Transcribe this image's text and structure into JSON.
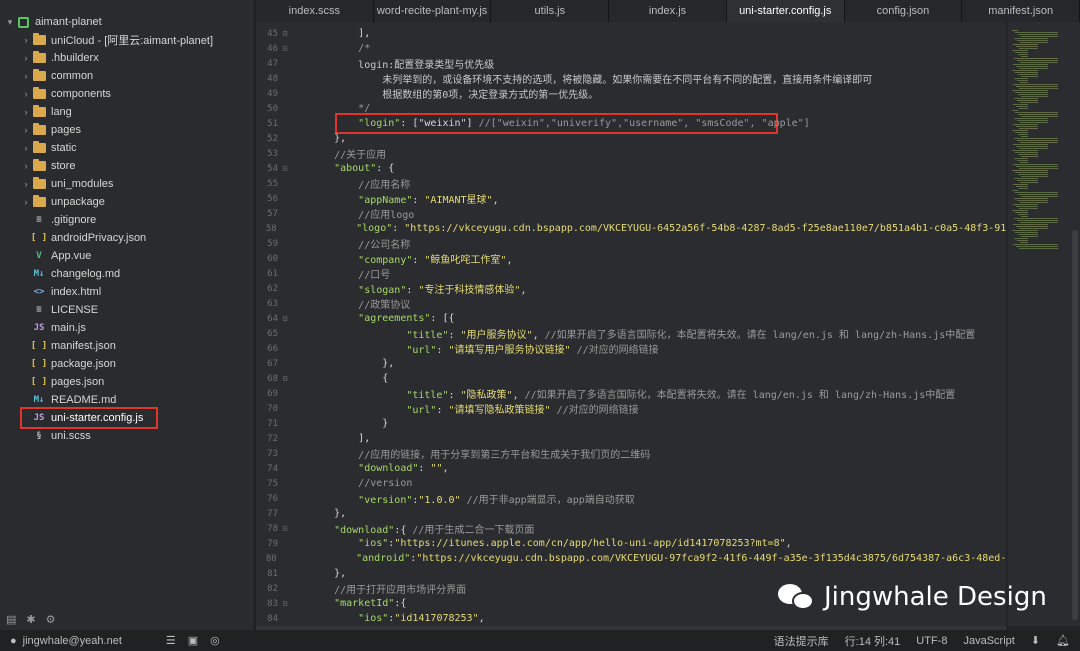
{
  "sidebar": {
    "root": "aimant-planet",
    "items": [
      {
        "type": "folder",
        "label": "uniCloud - [阿里云:aimant-planet]"
      },
      {
        "type": "folder",
        "label": ".hbuilderx"
      },
      {
        "type": "folder",
        "label": "common"
      },
      {
        "type": "folder",
        "label": "components"
      },
      {
        "type": "folder",
        "label": "lang"
      },
      {
        "type": "folder",
        "label": "pages"
      },
      {
        "type": "folder",
        "label": "static"
      },
      {
        "type": "folder",
        "label": "store"
      },
      {
        "type": "folder",
        "label": "uni_modules"
      },
      {
        "type": "folder",
        "label": "unpackage"
      },
      {
        "type": "file",
        "icon": "doc",
        "label": ".gitignore"
      },
      {
        "type": "file",
        "icon": "json",
        "label": "androidPrivacy.json"
      },
      {
        "type": "file",
        "icon": "vue",
        "label": "App.vue"
      },
      {
        "type": "file",
        "icon": "md",
        "label": "changelog.md"
      },
      {
        "type": "file",
        "icon": "html",
        "label": "index.html"
      },
      {
        "type": "file",
        "icon": "doc",
        "label": "LICENSE"
      },
      {
        "type": "file",
        "icon": "js",
        "label": "main.js"
      },
      {
        "type": "file",
        "icon": "json",
        "label": "manifest.json"
      },
      {
        "type": "file",
        "icon": "json",
        "label": "package.json"
      },
      {
        "type": "file",
        "icon": "json",
        "label": "pages.json"
      },
      {
        "type": "file",
        "icon": "md",
        "label": "README.md"
      },
      {
        "type": "file",
        "icon": "js",
        "label": "uni-starter.config.js",
        "selected": true
      },
      {
        "type": "file",
        "icon": "css",
        "label": "uni.scss"
      }
    ]
  },
  "tabs": [
    {
      "label": "index.scss"
    },
    {
      "label": "word-recite-plant-my.js"
    },
    {
      "label": "utils.js"
    },
    {
      "label": "index.js"
    },
    {
      "label": "uni-starter.config.js",
      "active": true
    },
    {
      "label": "config.json"
    },
    {
      "label": "manifest.json"
    }
  ],
  "editor": {
    "lines": [
      {
        "n": "45",
        "fold": "⊟",
        "indent": "        ",
        "tokens": [
          [
            "p",
            "],"
          ]
        ]
      },
      {
        "n": "46",
        "fold": "⊟",
        "indent": "        ",
        "tokens": [
          [
            "c",
            "/*"
          ]
        ]
      },
      {
        "n": "47",
        "fold": "",
        "indent": "        ",
        "tokens": [
          [
            "cn",
            "login:配置登录类型与优先级"
          ]
        ]
      },
      {
        "n": "48",
        "fold": "",
        "indent": "            ",
        "tokens": [
          [
            "cn",
            "未列举到的，或设备环境不支持的选项，将被隐藏。如果你需要在不同平台有不同的配置，直接用条件编译即可"
          ]
        ]
      },
      {
        "n": "49",
        "fold": "",
        "indent": "            ",
        "tokens": [
          [
            "cn",
            "根据数组的第0项，决定登录方式的第一优先级。"
          ]
        ]
      },
      {
        "n": "50",
        "fold": "",
        "indent": "        ",
        "tokens": [
          [
            "c",
            "*/"
          ]
        ]
      },
      {
        "n": "51",
        "fold": "",
        "indent": "        ",
        "tokens": [
          [
            "k",
            "\"login\""
          ],
          [
            "p",
            ": [\"weixin\"] "
          ],
          [
            "c",
            "//[\"weixin\",\"univerify\",\"username\", \"smsCode\", \"apple\"]"
          ]
        ]
      },
      {
        "n": "52",
        "fold": "",
        "indent": "    ",
        "tokens": [
          [
            "p",
            "},"
          ]
        ]
      },
      {
        "n": "53",
        "fold": "",
        "indent": "    ",
        "tokens": [
          [
            "c",
            "//关于应用"
          ]
        ]
      },
      {
        "n": "54",
        "fold": "⊟",
        "indent": "    ",
        "tokens": [
          [
            "k",
            "\"about\""
          ],
          [
            "p",
            ": {"
          ]
        ]
      },
      {
        "n": "55",
        "fold": "",
        "indent": "        ",
        "tokens": [
          [
            "c",
            "//应用名称"
          ]
        ]
      },
      {
        "n": "56",
        "fold": "",
        "indent": "        ",
        "tokens": [
          [
            "k",
            "\"appName\""
          ],
          [
            "p",
            ": "
          ],
          [
            "s",
            "\"AIMANT星球\""
          ],
          [
            "p",
            ","
          ]
        ]
      },
      {
        "n": "57",
        "fold": "",
        "indent": "        ",
        "tokens": [
          [
            "c",
            "//应用logo"
          ]
        ]
      },
      {
        "n": "58",
        "fold": "",
        "indent": "        ",
        "tokens": [
          [
            "k",
            "\"logo\""
          ],
          [
            "p",
            ": "
          ],
          [
            "s",
            "\"https://vkceyugu.cdn.bspapp.com/VKCEYUGU-6452a56f-54b8-4287-8ad5-f25e8ae110e7/b851a4b1-c0a5-48f3-9164-e059"
          ]
        ]
      },
      {
        "n": "59",
        "fold": "",
        "indent": "        ",
        "tokens": [
          [
            "c",
            "//公司名称"
          ]
        ]
      },
      {
        "n": "60",
        "fold": "",
        "indent": "        ",
        "tokens": [
          [
            "k",
            "\"company\""
          ],
          [
            "p",
            ": "
          ],
          [
            "s",
            "\"鲸鱼叱咤工作室\""
          ],
          [
            "p",
            ","
          ]
        ]
      },
      {
        "n": "61",
        "fold": "",
        "indent": "        ",
        "tokens": [
          [
            "c",
            "//口号"
          ]
        ]
      },
      {
        "n": "62",
        "fold": "",
        "indent": "        ",
        "tokens": [
          [
            "k",
            "\"slogan\""
          ],
          [
            "p",
            ": "
          ],
          [
            "s",
            "\"专注于科技情感体验\""
          ],
          [
            "p",
            ","
          ]
        ]
      },
      {
        "n": "63",
        "fold": "",
        "indent": "        ",
        "tokens": [
          [
            "c",
            "//政策协议"
          ]
        ]
      },
      {
        "n": "64",
        "fold": "⊟",
        "indent": "        ",
        "tokens": [
          [
            "k",
            "\"agreements\""
          ],
          [
            "p",
            ": [{"
          ]
        ]
      },
      {
        "n": "65",
        "fold": "",
        "indent": "                ",
        "tokens": [
          [
            "k",
            "\"title\""
          ],
          [
            "p",
            ": "
          ],
          [
            "s",
            "\"用户服务协议\""
          ],
          [
            "p",
            ", "
          ],
          [
            "c",
            "//如果开启了多语言国际化，本配置将失效。请在 lang/en.js 和 lang/zh-Hans.js中配置"
          ]
        ]
      },
      {
        "n": "66",
        "fold": "",
        "indent": "                ",
        "tokens": [
          [
            "k",
            "\"url\""
          ],
          [
            "p",
            ": "
          ],
          [
            "s",
            "\"请填写用户服务协议链接\""
          ],
          [
            "p",
            " "
          ],
          [
            "c",
            "//对应的网络链接"
          ]
        ]
      },
      {
        "n": "67",
        "fold": "",
        "indent": "            ",
        "tokens": [
          [
            "p",
            "},"
          ]
        ]
      },
      {
        "n": "68",
        "fold": "⊟",
        "indent": "            ",
        "tokens": [
          [
            "p",
            "{"
          ]
        ]
      },
      {
        "n": "69",
        "fold": "",
        "indent": "                ",
        "tokens": [
          [
            "k",
            "\"title\""
          ],
          [
            "p",
            ": "
          ],
          [
            "s",
            "\"隐私政策\""
          ],
          [
            "p",
            ", "
          ],
          [
            "c",
            "//如果开启了多语言国际化，本配置将失效。请在 lang/en.js 和 lang/zh-Hans.js中配置"
          ]
        ]
      },
      {
        "n": "70",
        "fold": "",
        "indent": "                ",
        "tokens": [
          [
            "k",
            "\"url\""
          ],
          [
            "p",
            ": "
          ],
          [
            "s",
            "\"请填写隐私政策链接\""
          ],
          [
            "p",
            " "
          ],
          [
            "c",
            "//对应的网络链接"
          ]
        ]
      },
      {
        "n": "71",
        "fold": "",
        "indent": "            ",
        "tokens": [
          [
            "p",
            "}"
          ]
        ]
      },
      {
        "n": "72",
        "fold": "",
        "indent": "        ",
        "tokens": [
          [
            "p",
            "],"
          ]
        ]
      },
      {
        "n": "73",
        "fold": "",
        "indent": "        ",
        "tokens": [
          [
            "c",
            "//应用的链接，用于分享到第三方平台和生成关于我们页的二维码"
          ]
        ]
      },
      {
        "n": "74",
        "fold": "",
        "indent": "        ",
        "tokens": [
          [
            "k",
            "\"download\""
          ],
          [
            "p",
            ": "
          ],
          [
            "s",
            "\"\""
          ],
          [
            "p",
            ","
          ]
        ]
      },
      {
        "n": "75",
        "fold": "",
        "indent": "        ",
        "tokens": [
          [
            "c",
            "//version"
          ]
        ]
      },
      {
        "n": "76",
        "fold": "",
        "indent": "        ",
        "tokens": [
          [
            "k",
            "\"version\""
          ],
          [
            "p",
            ":"
          ],
          [
            "s",
            "\"1.0.0\""
          ],
          [
            "p",
            " "
          ],
          [
            "c",
            "//用于非app端显示，app端自动获取"
          ]
        ]
      },
      {
        "n": "77",
        "fold": "",
        "indent": "    ",
        "tokens": [
          [
            "p",
            "},"
          ]
        ]
      },
      {
        "n": "78",
        "fold": "⊟",
        "indent": "    ",
        "tokens": [
          [
            "k",
            "\"download\""
          ],
          [
            "p",
            ":{ "
          ],
          [
            "c",
            "//用于生成二合一下载页面"
          ]
        ]
      },
      {
        "n": "79",
        "fold": "",
        "indent": "        ",
        "tokens": [
          [
            "k",
            "\"ios\""
          ],
          [
            "p",
            ":"
          ],
          [
            "s",
            "\"https://itunes.apple.com/cn/app/hello-uni-app/id1417078253?mt=8\""
          ],
          [
            "p",
            ","
          ]
        ]
      },
      {
        "n": "80",
        "fold": "",
        "indent": "        ",
        "tokens": [
          [
            "k",
            "\"android\""
          ],
          [
            "p",
            ":"
          ],
          [
            "s",
            "\"https://vkceyugu.cdn.bspapp.com/VKCEYUGU-97fca9f2-41f6-449f-a35e-3f135d4c3875/6d754387-a6c3-48ed-8ad2-e8"
          ]
        ]
      },
      {
        "n": "81",
        "fold": "",
        "indent": "    ",
        "tokens": [
          [
            "p",
            "},"
          ]
        ]
      },
      {
        "n": "82",
        "fold": "",
        "indent": "    ",
        "tokens": [
          [
            "c",
            "//用于打开应用市场评分界面"
          ]
        ]
      },
      {
        "n": "83",
        "fold": "⊟",
        "indent": "    ",
        "tokens": [
          [
            "k",
            "\"marketId\""
          ],
          [
            "p",
            ":{"
          ]
        ]
      },
      {
        "n": "84",
        "fold": "",
        "indent": "        ",
        "tokens": [
          [
            "k",
            "\"ios\""
          ],
          [
            "p",
            ":"
          ],
          [
            "s",
            "\"id1417078253\""
          ],
          [
            "p",
            ","
          ]
        ]
      }
    ]
  },
  "statusbar": {
    "user": "jingwhale@yeah.net",
    "syntax_hint": "语法提示库",
    "position": "行:14  列:41",
    "encoding": "UTF-8",
    "language": "JavaScript"
  },
  "watermark": {
    "text": "Jingwhale Design"
  }
}
